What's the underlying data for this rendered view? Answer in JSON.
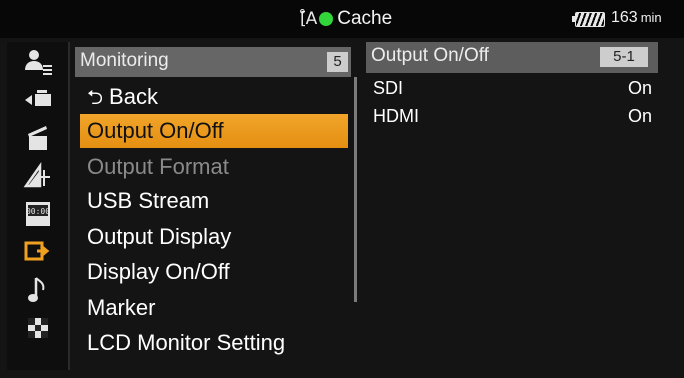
{
  "status": {
    "media_label": "Cache",
    "battery_minutes": "163",
    "battery_unit": "min",
    "indicator_color": "#33d63a"
  },
  "sidebar": {
    "categories": [
      {
        "icon": "user-menu-icon"
      },
      {
        "icon": "camera-record-icon"
      },
      {
        "icon": "clapperboard-icon"
      },
      {
        "icon": "picture-settings-icon"
      },
      {
        "icon": "timecode-icon"
      },
      {
        "icon": "output-monitoring-icon",
        "active": true
      },
      {
        "icon": "audio-note-icon"
      },
      {
        "icon": "checkerboard-icon"
      }
    ]
  },
  "menu": {
    "title": "Monitoring",
    "page_number": "5",
    "items": [
      {
        "label": "Back",
        "state": "normal"
      },
      {
        "label": "Output On/Off",
        "state": "selected"
      },
      {
        "label": "Output Format",
        "state": "disabled"
      },
      {
        "label": "USB Stream",
        "state": "normal"
      },
      {
        "label": "Output Display",
        "state": "normal"
      },
      {
        "label": "Display On/Off",
        "state": "normal"
      },
      {
        "label": "Marker",
        "state": "normal"
      },
      {
        "label": "LCD Monitor Setting",
        "state": "normal"
      }
    ]
  },
  "detail": {
    "title": "Output On/Off",
    "page_number": "5-1",
    "rows": [
      {
        "name": "SDI",
        "value": "On"
      },
      {
        "name": "HDMI",
        "value": "On"
      }
    ]
  },
  "colors": {
    "selection": "#eb9a1c",
    "active_icon": "#f0a020",
    "disabled_text": "#8a8a8a"
  }
}
